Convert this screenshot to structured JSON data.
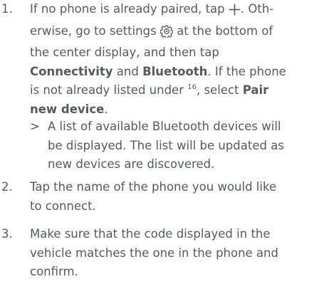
{
  "steps": [
    {
      "number": "1.",
      "text": {
        "l1_a": "If no phone is already paired, tap",
        "plus_icon": "plus-icon",
        "l1_b": ". Oth-",
        "l2_a": "erwise, go to settings",
        "settings_icon": "settings-gear-icon",
        "l2_b": "at the bottom of",
        "l3": "the center display, and then tap",
        "l4_bold1": "Connectivity",
        "l4_and": "and",
        "l4_bold2": "Bluetooth",
        "l4_end": ". If the phone",
        "l5_a": "is not already listed under",
        "l5_sup": "16",
        "l5_b": ", select",
        "l5_bold": "Pair",
        "l6_bold": "new device",
        "l6_end": "."
      },
      "result": {
        "marker": ">",
        "lines": [
          "A list of available Bluetooth devices will",
          "be displayed. The list will be updated as",
          "new devices are discovered."
        ]
      }
    },
    {
      "number": "2.",
      "lines": [
        "Tap the name of the phone you would like",
        "to connect."
      ]
    },
    {
      "number": "3.",
      "lines": [
        "Make sure that the code displayed in the",
        "vehicle matches the one in the phone and",
        "confirm."
      ]
    }
  ]
}
